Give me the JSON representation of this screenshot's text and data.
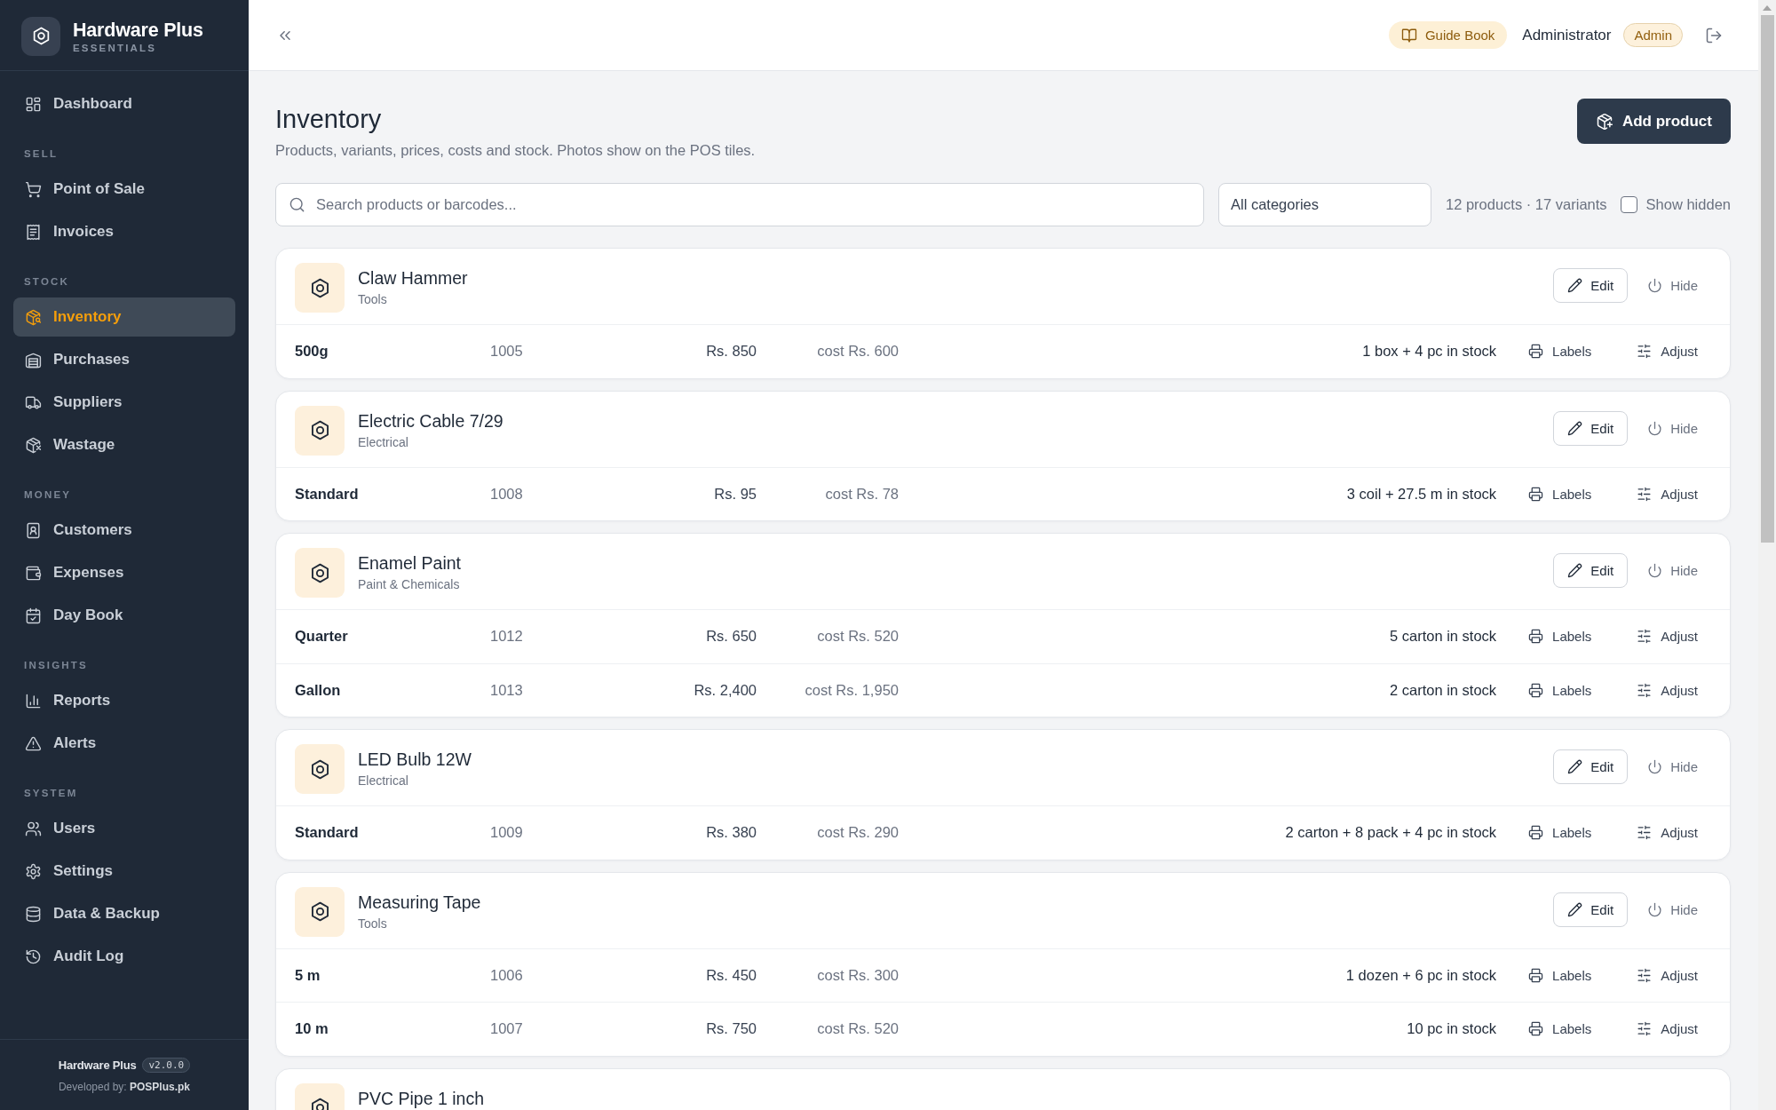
{
  "sidebar": {
    "brand": {
      "name": "Hardware Plus",
      "tagline": "ESSENTIALS"
    },
    "sections": [
      {
        "items": [
          {
            "label": "Dashboard",
            "selected": false
          }
        ]
      },
      {
        "heading": "SELL",
        "items": [
          {
            "label": "Point of Sale",
            "selected": false
          },
          {
            "label": "Invoices",
            "selected": false
          }
        ]
      },
      {
        "heading": "STOCK",
        "items": [
          {
            "label": "Inventory",
            "selected": true
          },
          {
            "label": "Purchases",
            "selected": false
          },
          {
            "label": "Suppliers",
            "selected": false
          },
          {
            "label": "Wastage",
            "selected": false
          }
        ]
      },
      {
        "heading": "MONEY",
        "items": [
          {
            "label": "Customers",
            "selected": false
          },
          {
            "label": "Expenses",
            "selected": false
          },
          {
            "label": "Day Book",
            "selected": false
          }
        ]
      },
      {
        "heading": "INSIGHTS",
        "items": [
          {
            "label": "Reports",
            "selected": false
          },
          {
            "label": "Alerts",
            "selected": false
          }
        ]
      },
      {
        "heading": "SYSTEM",
        "items": [
          {
            "label": "Users",
            "selected": false
          },
          {
            "label": "Settings",
            "selected": false
          },
          {
            "label": "Data & Backup",
            "selected": false
          },
          {
            "label": "Audit Log",
            "selected": false
          }
        ]
      }
    ],
    "footer": {
      "app_name": "Hardware Plus",
      "version": "v2.0.0",
      "credit": "Developed by: **POSPlus.pk**"
    }
  },
  "header": {
    "guide_button": "Guide Book",
    "user_name": "Administrator",
    "role_badge": "Admin"
  },
  "page": {
    "title": "Inventory",
    "subtitle": "Products, variants, prices, costs and stock. Photos show on the POS tiles.",
    "add_button": "Add product",
    "toolbar": {
      "search": {
        "placeholder": "Search products or barcodes..."
      },
      "category_filter": {
        "value": "All categories"
      },
      "summary": "12 products · 17 variants",
      "show_hidden": {
        "label": "Show hidden",
        "checked": false
      }
    },
    "products": [
      {
        "name": "Claw Hammer",
        "category": "Tools",
        "edit": "Edit",
        "hide": "Hide",
        "variants": [
          {
            "name": "500g",
            "code": "1005",
            "price": "Rs. 850",
            "cost": "cost Rs. 600",
            "stock": "1 box + 4 pc in stock",
            "labels": "Labels",
            "adjust": "Adjust"
          }
        ]
      },
      {
        "name": "Electric Cable 7/29",
        "category": "Electrical",
        "edit": "Edit",
        "hide": "Hide",
        "variants": [
          {
            "name": "Standard",
            "code": "1008",
            "price": "Rs. 95",
            "cost": "cost Rs. 78",
            "stock": "3 coil + 27.5 m in stock",
            "labels": "Labels",
            "adjust": "Adjust"
          }
        ]
      },
      {
        "name": "Enamel Paint",
        "category": "Paint & Chemicals",
        "edit": "Edit",
        "hide": "Hide",
        "variants": [
          {
            "name": "Quarter",
            "code": "1012",
            "price": "Rs. 650",
            "cost": "cost Rs. 520",
            "stock": "5 carton in stock",
            "labels": "Labels",
            "adjust": "Adjust"
          },
          {
            "name": "Gallon",
            "code": "1013",
            "price": "Rs. 2,400",
            "cost": "cost Rs. 1,950",
            "stock": "2 carton in stock",
            "labels": "Labels",
            "adjust": "Adjust"
          }
        ]
      },
      {
        "name": "LED Bulb 12W",
        "category": "Electrical",
        "edit": "Edit",
        "hide": "Hide",
        "variants": [
          {
            "name": "Standard",
            "code": "1009",
            "price": "Rs. 380",
            "cost": "cost Rs. 290",
            "stock": "2 carton + 8 pack + 4 pc in stock",
            "labels": "Labels",
            "adjust": "Adjust"
          }
        ]
      },
      {
        "name": "Measuring Tape",
        "category": "Tools",
        "edit": "Edit",
        "hide": "Hide",
        "variants": [
          {
            "name": "5 m",
            "code": "1006",
            "price": "Rs. 450",
            "cost": "cost Rs. 300",
            "stock": "1 dozen + 6 pc in stock",
            "labels": "Labels",
            "adjust": "Adjust"
          },
          {
            "name": "10 m",
            "code": "1007",
            "price": "Rs. 750",
            "cost": "cost Rs. 520",
            "stock": "10 pc in stock",
            "labels": "Labels",
            "adjust": "Adjust"
          }
        ]
      },
      {
        "name": "PVC Pipe 1 inch"
      }
    ]
  }
}
